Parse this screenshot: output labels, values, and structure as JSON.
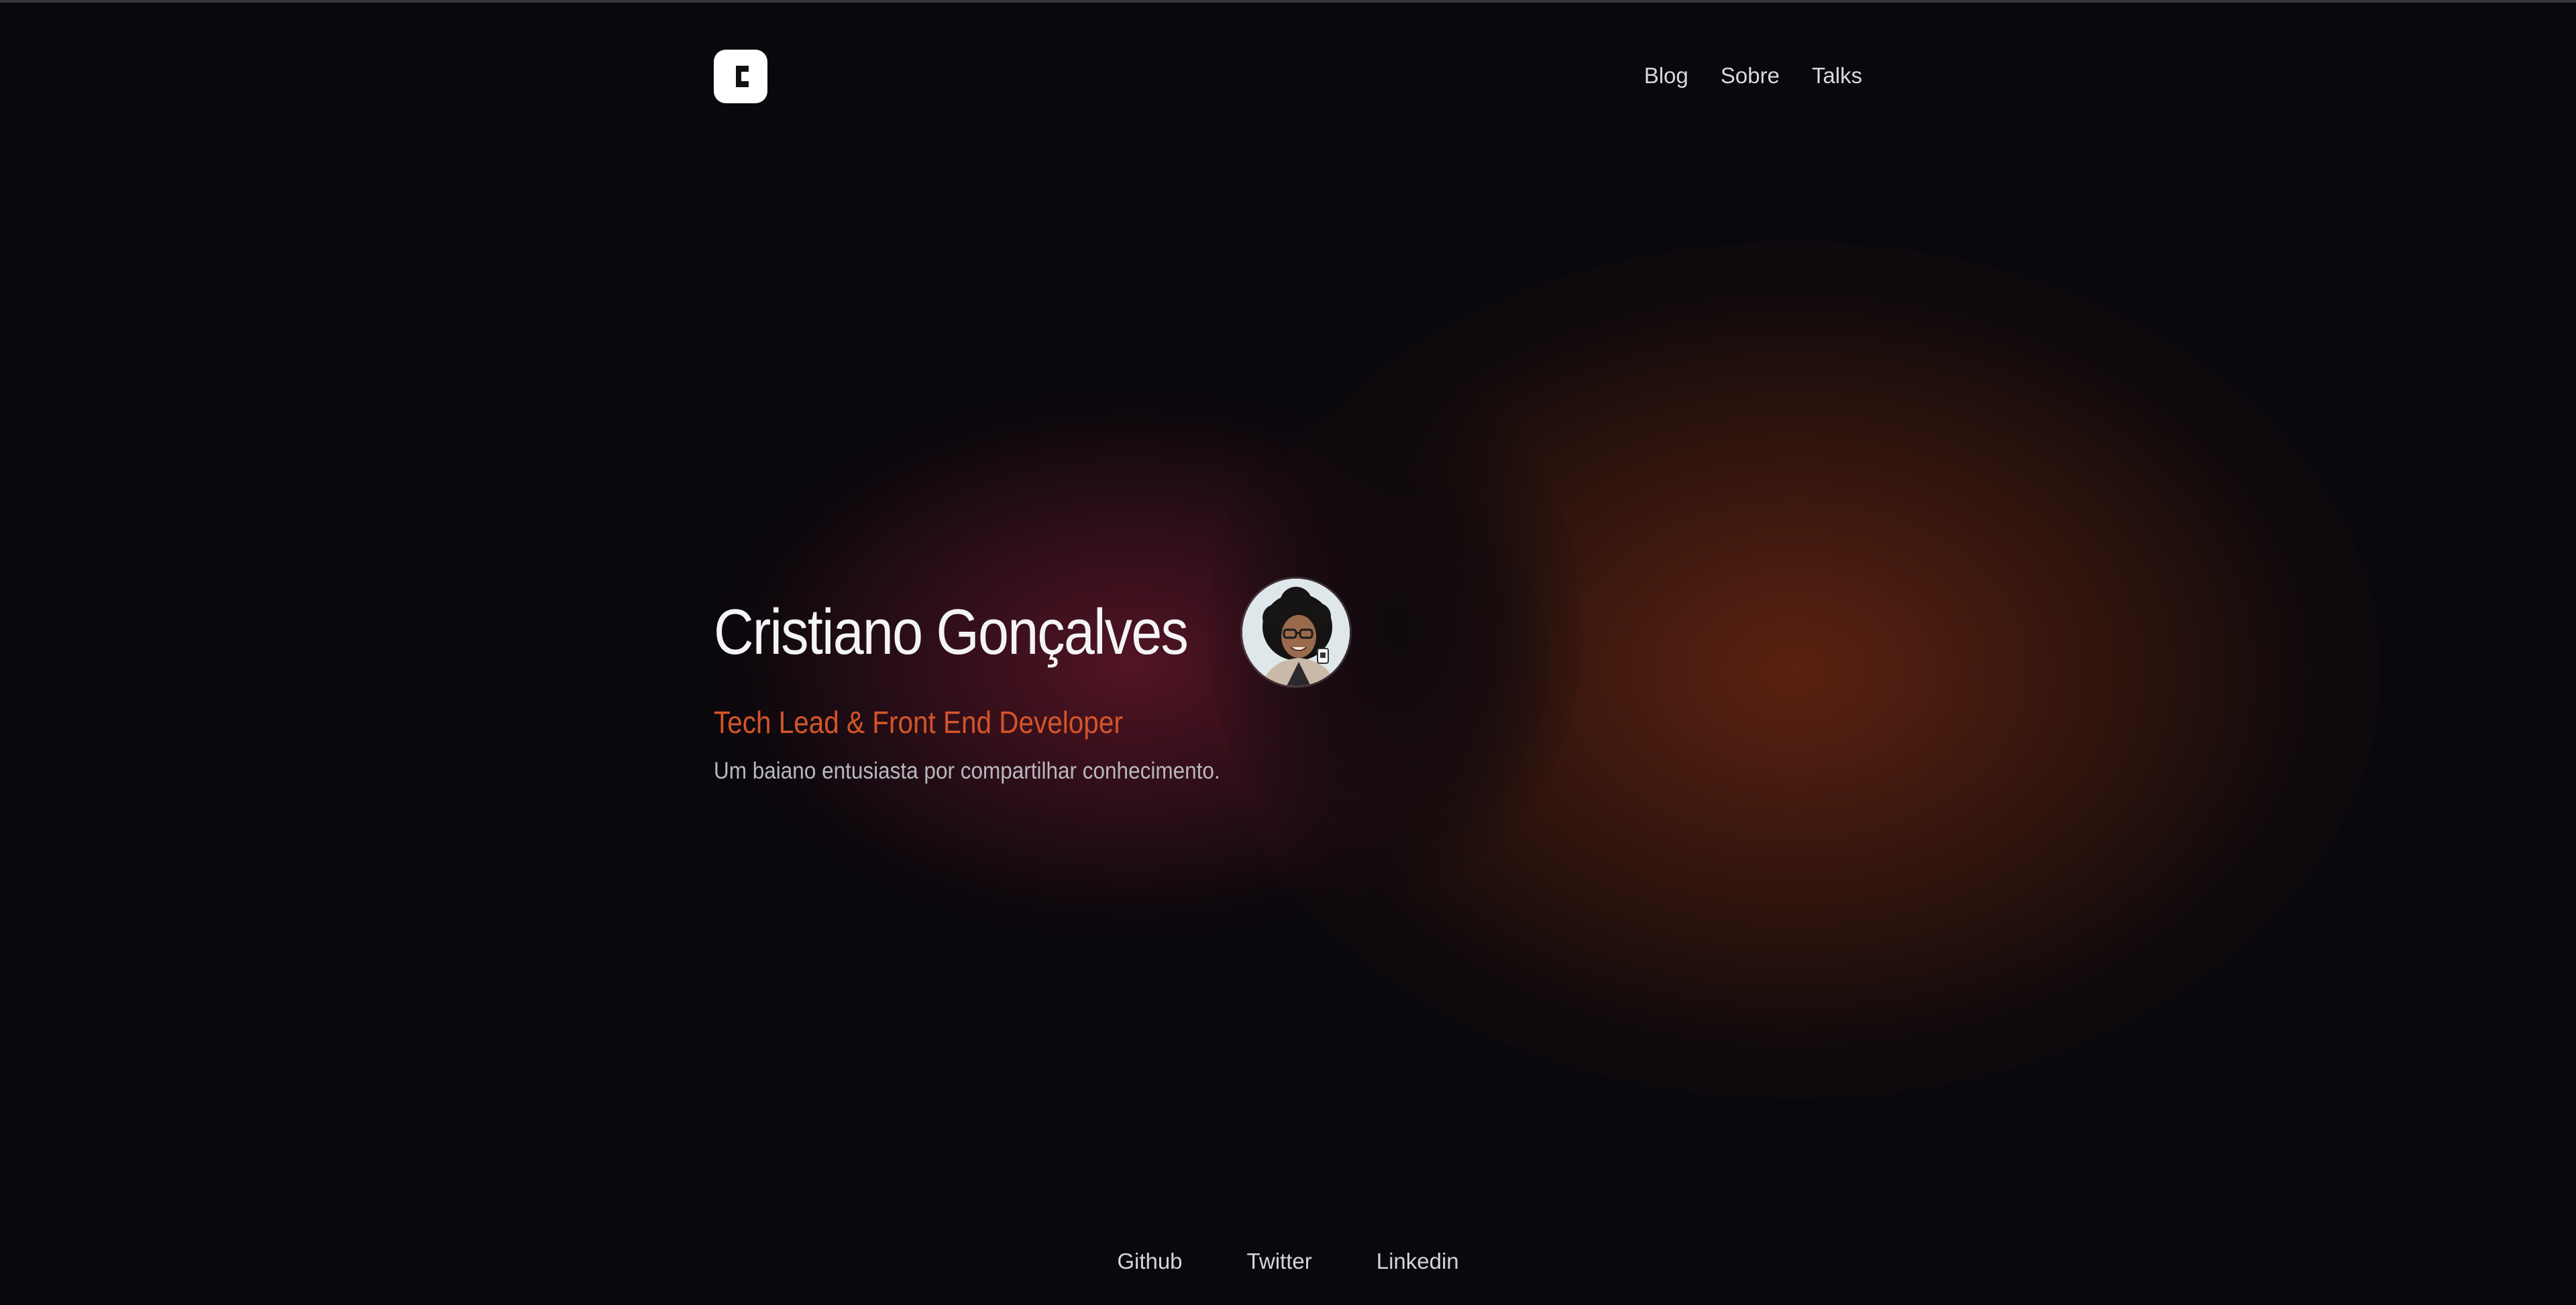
{
  "header": {
    "logo_icon": "c-logo-icon",
    "nav": [
      {
        "label": "Blog"
      },
      {
        "label": "Sobre"
      },
      {
        "label": "Talks"
      }
    ]
  },
  "hero": {
    "name": "Cristiano Gonçalves",
    "avatar_icon": "profile-photo",
    "subtitle": "Tech Lead & Front End Developer",
    "tagline": "Um baiano entusiasta por compartilhar conhecimento."
  },
  "footer": {
    "links": [
      {
        "label": "Github"
      },
      {
        "label": "Twitter"
      },
      {
        "label": "Linkedin"
      }
    ]
  },
  "colors": {
    "background": "#09080c",
    "accent": "#d4552a",
    "text": "#f4f4f6"
  }
}
